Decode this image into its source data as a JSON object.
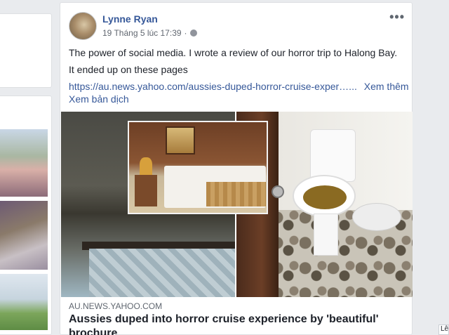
{
  "post": {
    "author": "Lynne Ryan",
    "timestamp": "19 Tháng 5 lúc 17:39",
    "separator": "·",
    "privacy_icon": "globe-icon",
    "more_icon": "ellipsis-icon",
    "more_glyph": "•••",
    "text_line1": "The power of social media. I wrote a review of our horror trip to Halong Bay.",
    "text_line2": "It ended up on these pages",
    "link_text": "https://au.news.yahoo.com/aussies-duped-horror-cruise-exper…...",
    "see_more": "Xem thêm",
    "translate": "Xem bản dịch"
  },
  "link_preview": {
    "source": "AU.NEWS.YAHOO.COM",
    "headline": "Aussies duped into horror cruise experience by 'beautiful' brochure"
  },
  "right_edge_label": "Lê"
}
